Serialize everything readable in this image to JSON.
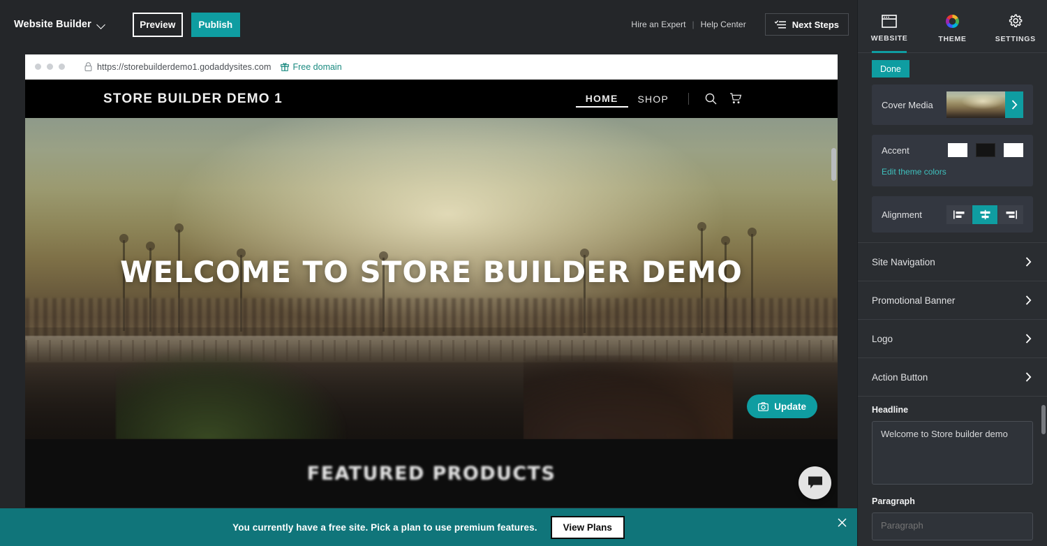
{
  "topbar": {
    "brand": "Website Builder",
    "brand_caret_icon": "chevron-down-icon",
    "preview_label": "Preview",
    "publish_label": "Publish",
    "hire_expert": "Hire an Expert",
    "separator": "|",
    "help_center": "Help Center",
    "next_steps_label": "Next Steps",
    "next_steps_icon": "checklist-icon"
  },
  "browser": {
    "lock_icon": "lock-icon",
    "url": "https://storebuilderdemo1.godaddysites.com",
    "free_domain_label": "Free domain",
    "free_domain_icon": "gift-icon"
  },
  "site": {
    "logo_text": "STORE BUILDER DEMO 1",
    "nav": [
      {
        "label": "HOME",
        "active": true
      },
      {
        "label": "SHOP",
        "active": false
      }
    ],
    "search_icon": "search-icon",
    "cart_icon": "shopping-cart-icon",
    "hero_title": "WELCOME TO STORE BUILDER DEMO",
    "update_button_label": "Update",
    "update_button_icon": "camera-icon",
    "featured_title": "FEATURED PRODUCTS",
    "chat_icon": "chat-bubble-icon"
  },
  "banner": {
    "message": "You currently have a free site. Pick a plan to use premium features.",
    "cta_label": "View Plans",
    "close_icon": "close-icon"
  },
  "sidebar": {
    "tabs": [
      {
        "label": "WEBSITE",
        "icon": "browser-window-icon",
        "active": true
      },
      {
        "label": "THEME",
        "icon": "color-wheel-icon",
        "active": false
      },
      {
        "label": "SETTINGS",
        "icon": "gear-icon",
        "active": false
      }
    ],
    "done_label": "Done",
    "cover_media": {
      "label": "Cover Media",
      "arrow_icon": "chevron-right-icon"
    },
    "accent": {
      "label": "Accent",
      "swatches": [
        "#ffffff",
        "#141414",
        "#ffffff"
      ],
      "edit_link": "Edit theme colors"
    },
    "alignment": {
      "label": "Alignment",
      "options": [
        {
          "name": "align-left-icon",
          "active": false
        },
        {
          "name": "align-center-icon",
          "active": true
        },
        {
          "name": "align-right-icon",
          "active": false
        }
      ]
    },
    "sections": [
      {
        "label": "Site Navigation",
        "icon": "chevron-right-icon"
      },
      {
        "label": "Promotional Banner",
        "icon": "chevron-right-icon"
      },
      {
        "label": "Logo",
        "icon": "chevron-right-icon"
      },
      {
        "label": "Action Button",
        "icon": "chevron-right-icon"
      }
    ],
    "headline": {
      "label": "Headline",
      "value": "Welcome to Store builder demo",
      "placeholder": "Headline"
    },
    "paragraph": {
      "label": "Paragraph",
      "value": "",
      "placeholder": "Paragraph"
    }
  },
  "colors": {
    "accent_teal": "#0f9da1",
    "banner_teal": "#10757a",
    "panel_bg": "#2a2d31",
    "card_bg": "#333740",
    "topbar_bg": "#242629"
  }
}
